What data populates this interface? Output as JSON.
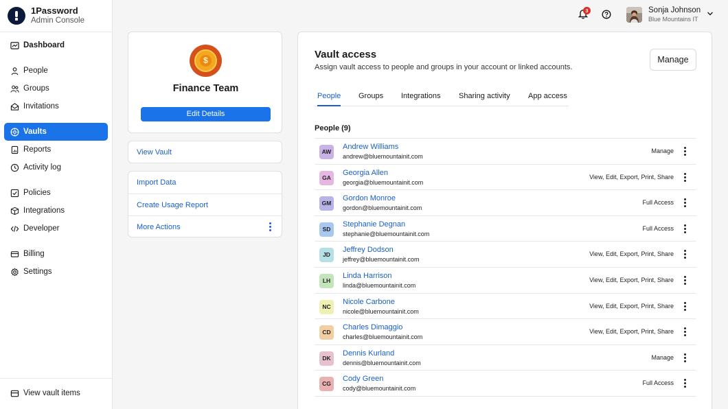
{
  "brand": {
    "name": "1Password",
    "subtitle": "Admin Console"
  },
  "sidebar": {
    "items": [
      {
        "label": "Dashboard",
        "icon": "dashboard-icon"
      },
      {
        "label": "People",
        "icon": "person-icon"
      },
      {
        "label": "Groups",
        "icon": "groups-icon"
      },
      {
        "label": "Invitations",
        "icon": "envelope-icon"
      },
      {
        "label": "Vaults",
        "icon": "vault-icon",
        "active": true
      },
      {
        "label": "Reports",
        "icon": "report-icon"
      },
      {
        "label": "Activity log",
        "icon": "clock-icon"
      },
      {
        "label": "Policies",
        "icon": "checkbox-icon"
      },
      {
        "label": "Integrations",
        "icon": "box-icon"
      },
      {
        "label": "Developer",
        "icon": "code-icon"
      },
      {
        "label": "Billing",
        "icon": "card-icon"
      },
      {
        "label": "Settings",
        "icon": "gear-icon"
      }
    ],
    "bottom": {
      "label": "View vault items",
      "icon": "vault-items-icon"
    }
  },
  "topbar": {
    "notification_count": "3",
    "user_name": "Sonja Johnson",
    "user_org": "Blue Mountains IT"
  },
  "team": {
    "name": "Finance Team",
    "edit_label": "Edit Details",
    "view_vault": "View Vault",
    "actions": [
      "Import Data",
      "Create Usage Report",
      "More Actions"
    ]
  },
  "vault_access": {
    "title": "Vault access",
    "subtitle": "Assign vault access to people and groups in your account or linked accounts.",
    "manage_label": "Manage",
    "tabs": [
      "People",
      "Groups",
      "Integrations",
      "Sharing activity",
      "App access"
    ],
    "people_heading": "People (9)",
    "people": [
      {
        "initials": "AW",
        "name": "Andrew Williams",
        "email": "andrew@bluemountainit.com",
        "access": "Manage",
        "color": "#c9b3e6"
      },
      {
        "initials": "GA",
        "name": "Georgia Allen",
        "email": "georgia@bluemountainit.com",
        "access": "View, Edit, Export, Print, Share",
        "color": "#e6b7e0"
      },
      {
        "initials": "GM",
        "name": "Gordon Monroe",
        "email": "gordon@bluemountainit.com",
        "access": "Full Access",
        "color": "#b7b4ea"
      },
      {
        "initials": "SD",
        "name": "Stephanie Degnan",
        "email": "stephanie@bluemountainit.com",
        "access": "Full Access",
        "color": "#a9c8ef"
      },
      {
        "initials": "JD",
        "name": "Jeffrey Dodson",
        "email": "jeffrey@bluemountainit.com",
        "access": "View, Edit, Export, Print, Share",
        "color": "#b4e0e6"
      },
      {
        "initials": "LH",
        "name": "Linda Harrison",
        "email": "linda@bluemountainit.com",
        "access": "View, Edit, Export, Print, Share",
        "color": "#c4e5b9"
      },
      {
        "initials": "NC",
        "name": "Nicole Carbone",
        "email": "nicole@bluemountainit.com",
        "access": "View, Edit, Export, Print, Share",
        "color": "#eef0b4"
      },
      {
        "initials": "CD",
        "name": "Charles Dimaggio",
        "email": "charles@bluemountainit.com",
        "access": "View, Edit, Export, Print, Share",
        "color": "#f1cfa3"
      },
      {
        "initials": "DK",
        "name": "Dennis Kurland",
        "email": "dennis@bluemountainit.com",
        "access": "Manage",
        "color": "#e6c2cf"
      },
      {
        "initials": "CG",
        "name": "Cody Green",
        "email": "cody@bluemountainit.com",
        "access": "Full Access",
        "color": "#eab1b1"
      }
    ]
  }
}
